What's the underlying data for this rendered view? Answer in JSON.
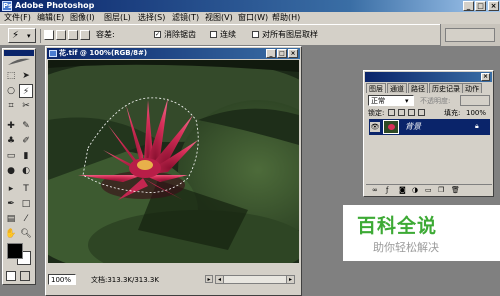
{
  "window": {
    "title": "Adobe Photoshop",
    "app_icon": "Ps"
  },
  "window_controls": {
    "minimize": "_",
    "maximize": "□",
    "close": "×"
  },
  "menu": [
    "文件(F)",
    "编辑(E)",
    "图像(I)",
    "图层(L)",
    "选择(S)",
    "滤镜(T)",
    "视图(V)",
    "窗口(W)",
    "帮助(H)"
  ],
  "options": {
    "tolerance_label": "容差:",
    "tolerance_value": "32",
    "antialias_label": "消除锯齿",
    "antialias_checked": true,
    "contiguous_label": "连续",
    "contiguous_checked": false,
    "all_layers_label": "对所有图层取样",
    "all_layers_checked": false
  },
  "document": {
    "title": "花.tif @ 100%(RGB/8#)",
    "zoom": "100%",
    "doc_size": "文档:313.3K/313.3K"
  },
  "layers_panel": {
    "tabs": [
      "图层",
      "通道",
      "路径",
      "历史记录",
      "动作"
    ],
    "blend_mode": "正常",
    "opacity_label": "不透明度:",
    "lock_label": "锁定:",
    "fill_label": "填充:",
    "fill_value": "100%",
    "layer_name": "背景"
  },
  "watermark": {
    "brand": "百科全说",
    "slogan": "助你轻松解决"
  },
  "colors": {
    "foreground": "#000000",
    "background": "#ffffff",
    "accent": "#0a246a",
    "logo_green": "#3daa35"
  }
}
